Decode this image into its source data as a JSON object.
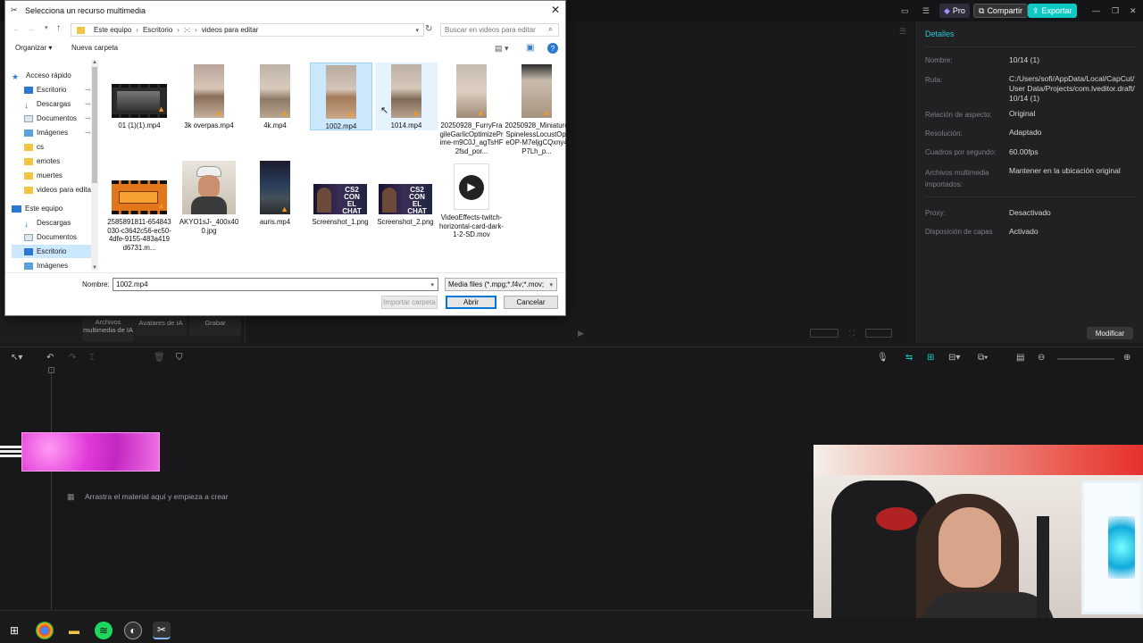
{
  "capcut": {
    "pro_label": "Pro",
    "share_label": "Compartir",
    "export_label": "Exportar",
    "details": {
      "title": "Detalles",
      "rows": [
        {
          "label": "Nombre:",
          "value": "10/14 (1)"
        },
        {
          "label": "Ruta:",
          "value": "C:/Users/sofi/AppData/Local/CapCut/ User Data/Projects/com.lveditor.draft/ 10/14 (1)"
        },
        {
          "label": "Relación de aspecto:",
          "value": "Original"
        },
        {
          "label": "Resolución:",
          "value": "Adaptado"
        },
        {
          "label": "Cuadros por segundo:",
          "value": "60.00fps"
        },
        {
          "label": "Archivos multimedia importados:",
          "value": "Mantener en la ubicación original"
        },
        {
          "label": "Proxy:",
          "value": "Desactivado"
        },
        {
          "label": "Disposición de capas",
          "value": "Activado"
        }
      ],
      "modify_label": "Modificar"
    },
    "media_tabs": [
      "Archivos multimedia de IA",
      "Avatares de IA",
      "Grabar"
    ],
    "timeline_hint": "Arrastra el material aquí y empieza a crear"
  },
  "dialog": {
    "title": "Selecciona un recurso multimedia",
    "breadcrumb": [
      "Este equipo",
      "Escritorio",
      ":-:",
      "videos para editar"
    ],
    "search_placeholder": "Buscar en videos para editar",
    "organize_label": "Organizar",
    "new_folder_label": "Nueva carpeta",
    "nav": {
      "quick_access": "Acceso rápido",
      "quick_items": [
        "Escritorio",
        "Descargas",
        "Documentos",
        "Imágenes",
        "cs",
        "emotes",
        "muertes",
        "videos para edita"
      ],
      "this_pc": "Este equipo",
      "pc_items": [
        "Descargas",
        "Documentos",
        "Escritorio",
        "Imágenes"
      ]
    },
    "files": [
      {
        "name": "01 (1)(1).mp4"
      },
      {
        "name": "3k overpas.mp4"
      },
      {
        "name": "4k.mp4"
      },
      {
        "name": "1002.mp4"
      },
      {
        "name": "1014.mp4"
      },
      {
        "name": "20250928_FurryFragileGarlicOptimizePrime-m9C0J_agTsHF2fsd_por..."
      },
      {
        "name": "20250928_MiniatureSpinelessLocustOpieOP-M7eljgCQxny4P7Lh_p..."
      },
      {
        "name": "2585891811-654843030-c3642c56-ec50-4dfe-9155-483a419d6731.m..."
      },
      {
        "name": "AKYO1sJ-_400x400.jpg"
      },
      {
        "name": "auris.mp4"
      },
      {
        "name": "Screenshot_1.png"
      },
      {
        "name": "Screenshot_2.png"
      },
      {
        "name": "VideoEffects-twitch-horizontal-card-dark-1-2-SD.mov"
      }
    ],
    "thumb_text": "CS2 CON EL CHAT",
    "filename_label": "Nombre:",
    "filename_value": "1002.mp4",
    "filter_value": "Media files (*.mpg;*.f4v;*.mov;",
    "import_folder_label": "Importar carpeta",
    "open_label": "Abrir",
    "cancel_label": "Cancelar"
  },
  "colors": {
    "accent_cyan": "#11c9c3",
    "selection": "#cce8ff",
    "clip_magenta": "#e23ad8"
  }
}
